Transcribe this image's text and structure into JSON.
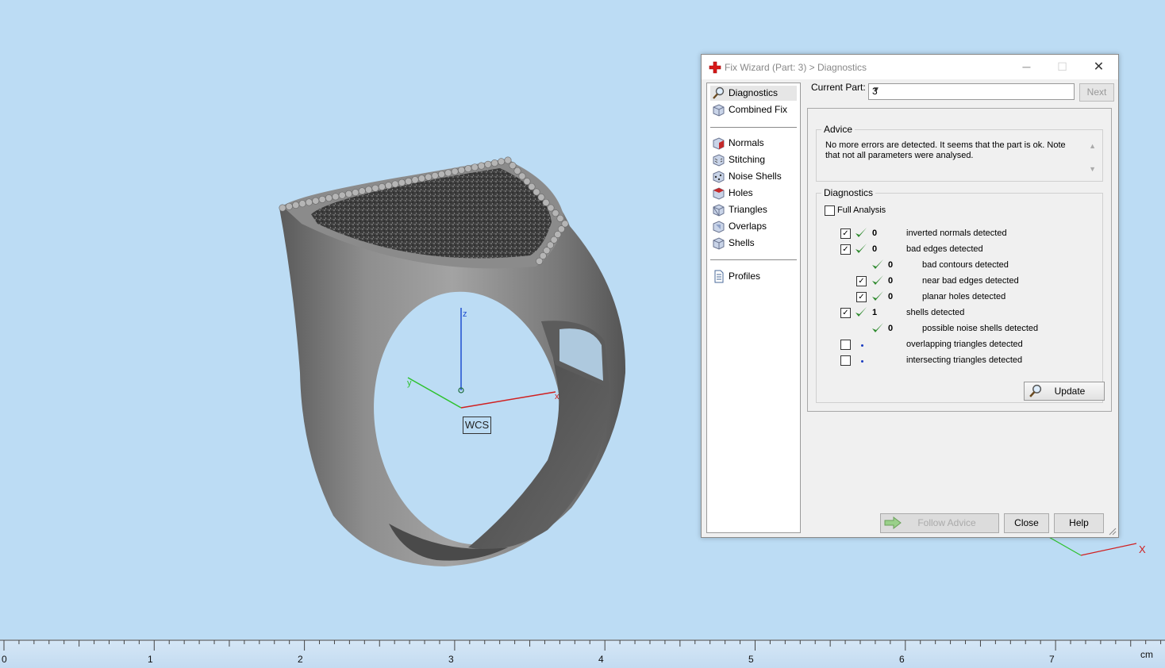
{
  "viewport": {
    "wcs_label": "WCS",
    "axis_labels": {
      "z": "z",
      "y": "y",
      "x": "x"
    },
    "corner_axis_x": "X"
  },
  "ruler": {
    "unit": "cm",
    "labels": [
      "0",
      "1",
      "2",
      "3",
      "4",
      "5",
      "6",
      "7"
    ]
  },
  "dialog": {
    "title": "Fix Wizard (Part: 3) > Diagnostics",
    "title_icon": "red-cross-icon",
    "window_buttons": {
      "minimize": "─",
      "maximize": "☐",
      "close": "✕"
    },
    "nav": {
      "items_top": [
        {
          "label": "Diagnostics",
          "icon": "magnifier-icon",
          "selected": true
        },
        {
          "label": "Combined Fix",
          "icon": "cube-icon"
        }
      ],
      "items_mid": [
        {
          "label": "Normals",
          "icon": "normals-cube-icon"
        },
        {
          "label": "Stitching",
          "icon": "stitching-cube-icon"
        },
        {
          "label": "Noise Shells",
          "icon": "noise-shells-icon"
        },
        {
          "label": "Holes",
          "icon": "holes-cube-icon"
        },
        {
          "label": "Triangles",
          "icon": "triangles-cube-icon"
        },
        {
          "label": "Overlaps",
          "icon": "overlaps-cube-icon"
        },
        {
          "label": "Shells",
          "icon": "shells-cube-icon"
        }
      ],
      "items_bottom": [
        {
          "label": "Profiles",
          "icon": "document-icon"
        }
      ]
    },
    "current_part_label": "Current Part:",
    "current_part_value": "3",
    "next_label": "Next",
    "advice": {
      "title": "Advice",
      "text": "No more errors are detected. It seems that the part is ok. Note that not all parameters were analysed."
    },
    "diagnostics": {
      "title": "Diagnostics",
      "full_analysis_label": "Full Analysis",
      "full_analysis_checked": false,
      "rows": [
        {
          "checked": true,
          "status": "ok",
          "value": "0",
          "text": "inverted normals detected"
        },
        {
          "checked": true,
          "status": "ok",
          "value": "0",
          "text": "bad edges detected"
        },
        {
          "checked": null,
          "status": "ok",
          "value": "0",
          "text": "bad contours detected"
        },
        {
          "checked": true,
          "status": "ok",
          "value": "0",
          "text": "near bad edges detected"
        },
        {
          "checked": true,
          "status": "ok",
          "value": "0",
          "text": "planar holes detected"
        },
        {
          "checked": true,
          "status": "ok",
          "value": "1",
          "text": "shells detected"
        },
        {
          "checked": null,
          "status": "ok",
          "value": "0",
          "text": "possible noise shells detected"
        },
        {
          "checked": false,
          "status": "none",
          "value": "",
          "text": "overlapping triangles detected"
        },
        {
          "checked": false,
          "status": "none",
          "value": "",
          "text": "intersecting triangles detected"
        }
      ],
      "update_label": "Update"
    },
    "buttons": {
      "follow_advice": "Follow Advice",
      "close": "Close",
      "help": "Help"
    }
  }
}
